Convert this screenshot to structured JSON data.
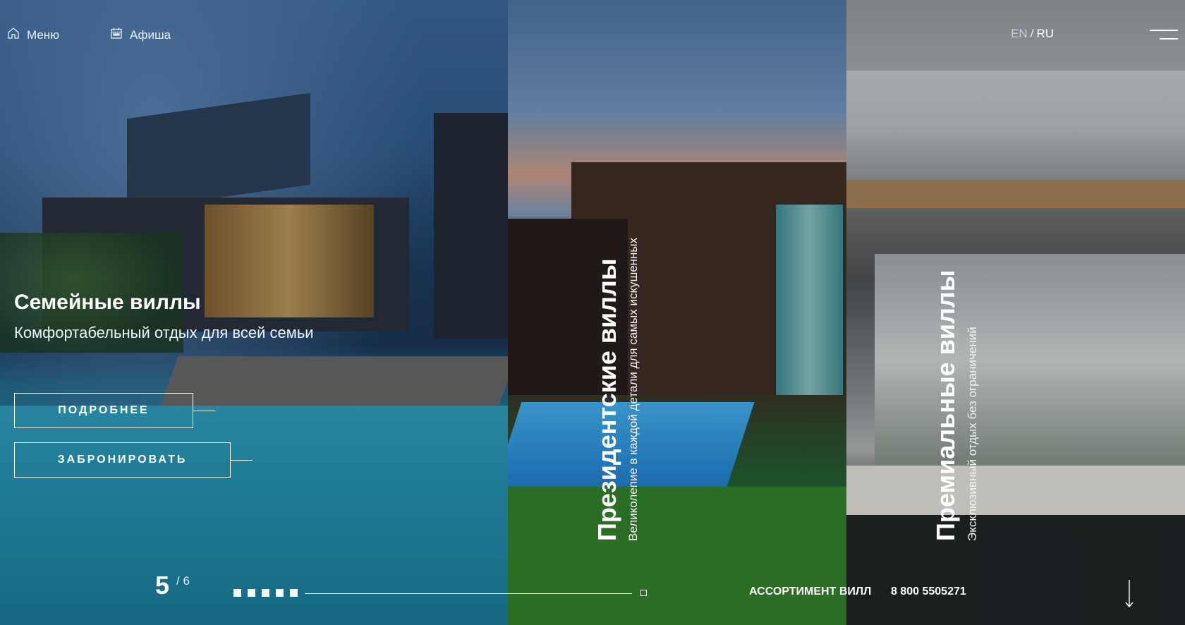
{
  "header": {
    "menu_label": "Меню",
    "events_label": "Афиша",
    "lang_inactive": "EN",
    "lang_separator": "/",
    "lang_active": "RU"
  },
  "slides": [
    {
      "title": "Семейные виллы",
      "subtitle": "Комфортабельный отдых для всей семьи",
      "more_button": "ПОДРОБНЕЕ",
      "book_button": "ЗАБРОНИРОВАТЬ"
    },
    {
      "title": "Президентские виллы",
      "subtitle": "Великолепие в каждой детали для самых искушенных"
    },
    {
      "title": "Премиальные виллы",
      "subtitle": "Эксклюзивный отдых без ограничений"
    }
  ],
  "pagination": {
    "current": "5",
    "total": "/ 6"
  },
  "footer": {
    "assortment_link": "АССОРТИМЕНТ ВИЛЛ",
    "phone": "8 800 5505271"
  },
  "icons": {
    "menu": "home-icon",
    "events": "calendar-icon",
    "burger": "hamburger-icon",
    "scroll": "arrow-down-icon"
  }
}
